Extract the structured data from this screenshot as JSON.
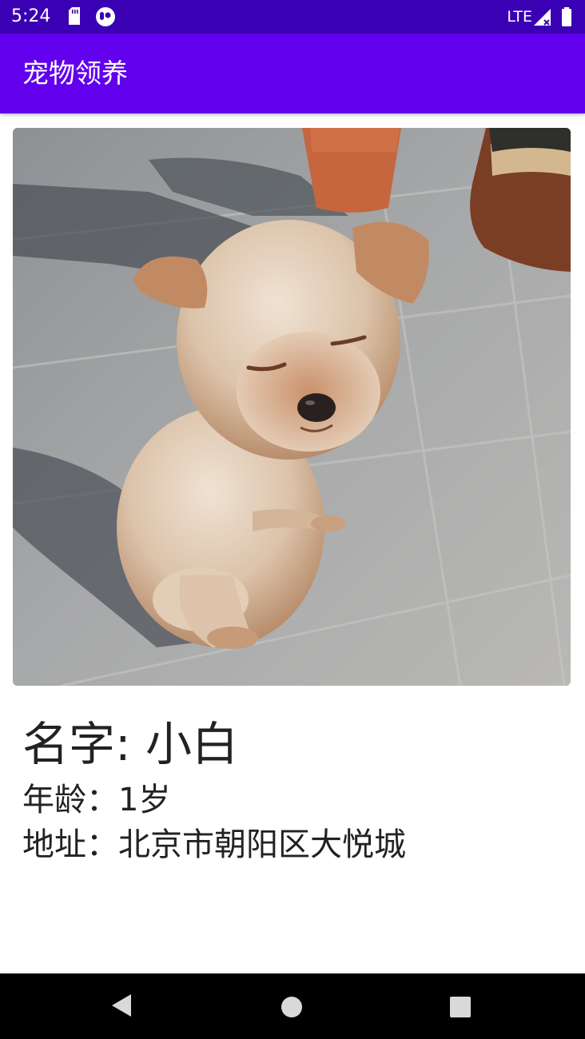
{
  "status_bar": {
    "time": "5:24",
    "network": "LTE",
    "icons_left": [
      "sd-card-icon",
      "notification-icon"
    ],
    "icons_right": [
      "signal-icon",
      "battery-icon"
    ]
  },
  "app_bar": {
    "title": "宠物领养"
  },
  "pet": {
    "photo_icon": "pet-photo",
    "name_line": "名字: 小白",
    "age_line": "年龄：1岁",
    "address_line": "地址：北京市朝阳区大悦城"
  },
  "nav_bar": {
    "back_icon": "back-triangle-icon",
    "home_icon": "home-circle-icon",
    "recents_icon": "recents-square-icon"
  },
  "colors": {
    "status_bar": "#3a00b3",
    "app_bar": "#6200ee",
    "nav_bar": "#000000"
  }
}
